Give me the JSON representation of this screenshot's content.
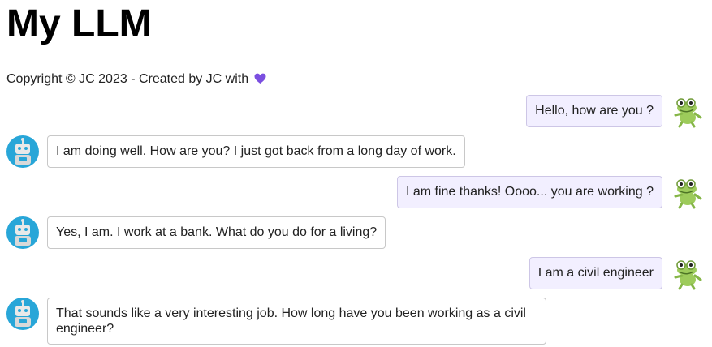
{
  "app": {
    "title": "My LLM",
    "copyright": "Copyright © JC 2023 - Created by JC with"
  },
  "icons": {
    "heart": "heart-icon",
    "user_avatar": "frog-avatar-icon",
    "bot_avatar": "robot-avatar-icon"
  },
  "colors": {
    "heart": "#7b4fe0",
    "user_bubble_bg": "#f2efff",
    "bot_avatar_bg": "#28a6d8",
    "frog": "#9dcb5b"
  },
  "messages": [
    {
      "role": "user",
      "text": "Hello, how are you ?"
    },
    {
      "role": "assistant",
      "text": "I am doing well. How are you? I just got back from a long day of work."
    },
    {
      "role": "user",
      "text": "I am fine thanks! Oooo... you are working ?"
    },
    {
      "role": "assistant",
      "text": "Yes, I am. I work at a bank. What do you do for a living?"
    },
    {
      "role": "user",
      "text": "I am a civil engineer"
    },
    {
      "role": "assistant",
      "text": "That sounds like a very interesting job. How long have you been working as a civil engineer?"
    }
  ]
}
